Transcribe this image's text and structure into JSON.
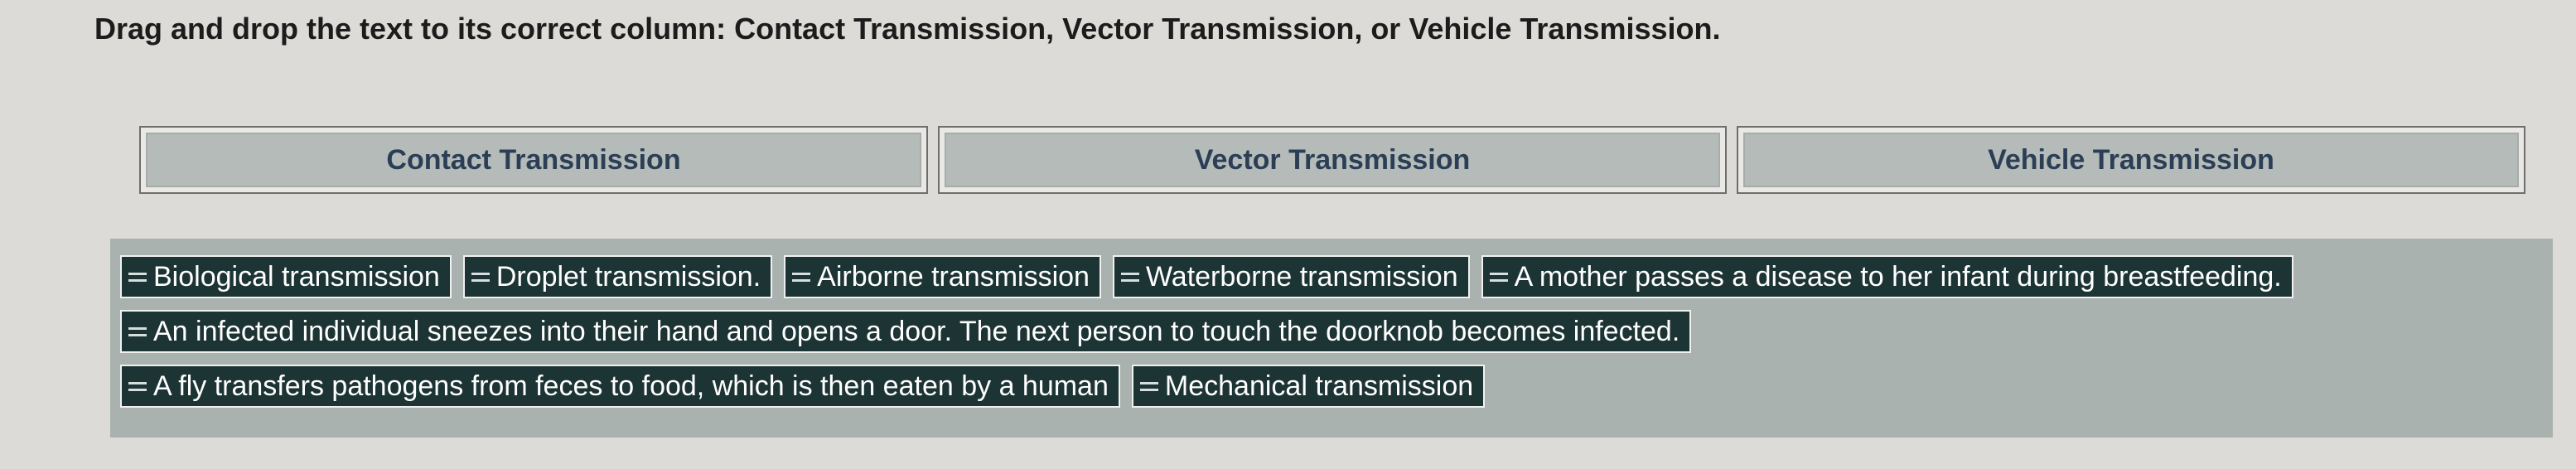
{
  "instruction": "Drag and drop the text to its correct column: Contact Transmission, Vector Transmission, or Vehicle Transmission.",
  "columns": [
    {
      "label": "Contact Transmission"
    },
    {
      "label": "Vector Transmission"
    },
    {
      "label": "Vehicle Transmission"
    }
  ],
  "drag_handle_icon": "drag-handle-icon",
  "bank": {
    "rows": [
      [
        {
          "label": "Biological transmission"
        },
        {
          "label": "Droplet transmission."
        },
        {
          "label": "Airborne transmission"
        },
        {
          "label": "Waterborne transmission"
        },
        {
          "label": "A mother passes a disease to her infant during breastfeeding."
        }
      ],
      [
        {
          "label": "An infected individual sneezes into their hand and opens a door. The next person to touch the doorknob becomes infected."
        }
      ],
      [
        {
          "label": "A fly transfers pathogens from feces to food, which is then eaten by a human"
        },
        {
          "label": "Mechanical transmission"
        }
      ]
    ]
  }
}
